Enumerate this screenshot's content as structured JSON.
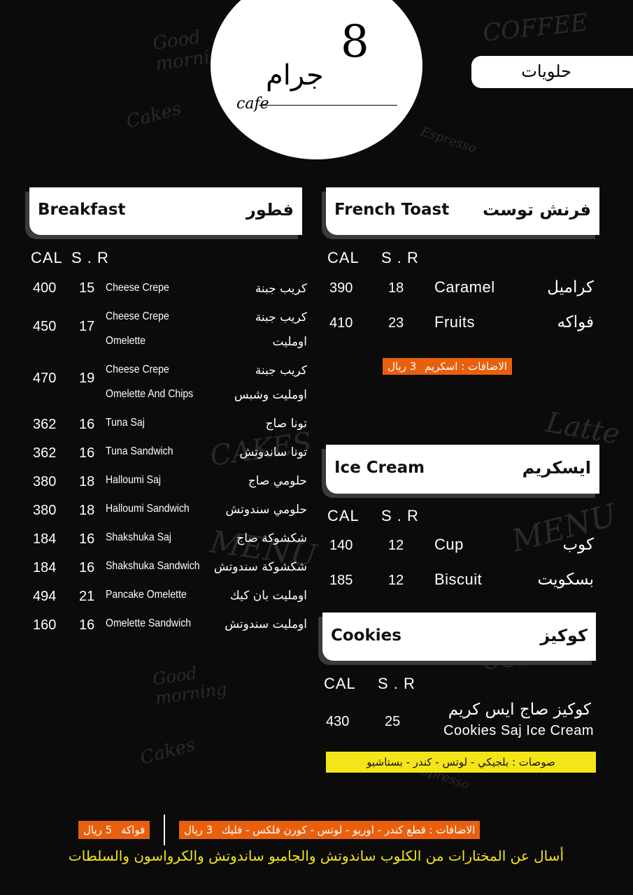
{
  "brand": {
    "logo_number": "8",
    "logo_arabic": "جرام",
    "logo_cafe": "cafe"
  },
  "section_tab": "حلويات",
  "columns": {
    "cal": "CAL",
    "sr": "S . R"
  },
  "breakfast": {
    "title_en": "Breakfast",
    "title_ar": "فطور",
    "items": [
      {
        "cal": "400",
        "sr": "15",
        "en": [
          "Cheese Crepe"
        ],
        "ar": [
          "كريب جبنة"
        ]
      },
      {
        "cal": "450",
        "sr": "17",
        "en": [
          "Cheese Crepe",
          "Omelette"
        ],
        "ar": [
          "كريب جبنة",
          "اومليت"
        ]
      },
      {
        "cal": "470",
        "sr": "19",
        "en": [
          "Cheese Crepe",
          "Omelette And Chips"
        ],
        "ar": [
          "كريب جبنة",
          "اومليت وشبس"
        ]
      },
      {
        "cal": "362",
        "sr": "16",
        "en": [
          "Tuna Saj"
        ],
        "ar": [
          "تونا صاج"
        ]
      },
      {
        "cal": "362",
        "sr": "16",
        "en": [
          "Tuna Sandwich"
        ],
        "ar": [
          "تونا ساندوتش"
        ]
      },
      {
        "cal": "380",
        "sr": "18",
        "en": [
          "Halloumi Saj"
        ],
        "ar": [
          "حلومي صاج"
        ]
      },
      {
        "cal": "380",
        "sr": "18",
        "en": [
          "Halloumi Sandwich"
        ],
        "ar": [
          "حلومي سندوتش"
        ]
      },
      {
        "cal": "184",
        "sr": "16",
        "en": [
          "Shakshuka Saj"
        ],
        "ar": [
          "شكشوكة صاج"
        ]
      },
      {
        "cal": "184",
        "sr": "16",
        "en": [
          "Shakshuka Sandwich"
        ],
        "ar": [
          "شكشوكة سندوتش"
        ]
      },
      {
        "cal": "494",
        "sr": "21",
        "en": [
          "Pancake Omelette"
        ],
        "ar": [
          "اومليت بان كيك"
        ]
      },
      {
        "cal": "160",
        "sr": "16",
        "en": [
          "Omelette Sandwich"
        ],
        "ar": [
          "اومليت سندوتش"
        ]
      }
    ]
  },
  "french_toast": {
    "title_en": "French Toast",
    "title_ar": "فرنش توست",
    "items": [
      {
        "cal": "390",
        "sr": "18",
        "en": "Caramel",
        "ar": "كراميل"
      },
      {
        "cal": "410",
        "sr": "23",
        "en": "Fruits",
        "ar": "فواكه"
      }
    ],
    "addon_label": "الاضافات : اسكريم",
    "addon_price": "3 ريال"
  },
  "ice_cream": {
    "title_en": "Ice Cream",
    "title_ar": "ايسكريم",
    "items": [
      {
        "cal": "140",
        "sr": "12",
        "en": "Cup",
        "ar": "كوب"
      },
      {
        "cal": "185",
        "sr": "12",
        "en": "Biscuit",
        "ar": "بسكويت"
      }
    ]
  },
  "cookies": {
    "title_en": "Cookies",
    "title_ar": "كوكيز",
    "item": {
      "cal": "430",
      "sr": "25",
      "ar": "كوكيز صاج ايس كريم",
      "en": "Cookies Saj Ice Cream"
    },
    "sauces": "صوصات : بلجيكي - لوتس - كندر - بستاشيو"
  },
  "footer": {
    "addons_label": "الاضافات : قطع كندر - اوريو - لوتس - كورن فلكس - فليك",
    "addons_price": "3 ريال",
    "fruit_label": "فواكة",
    "fruit_price": "5 ريال",
    "note": "أسال عن المختارات من الكلوب ساندوتش والجامبو ساندوتش والكرواسون والسلطات"
  },
  "colors": {
    "background": "#0b0b0b",
    "accent_orange": "#e8600e",
    "accent_yellow": "#f4e51a"
  }
}
